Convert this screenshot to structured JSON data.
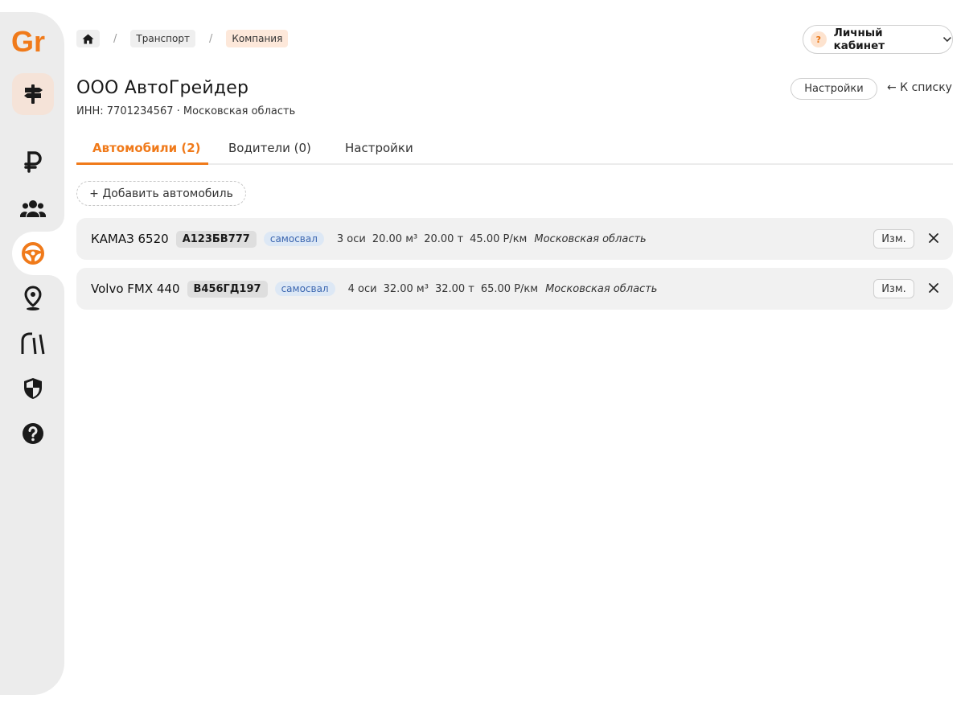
{
  "sidebar": {
    "logo": "Gr",
    "brand_color": "#f07a1a",
    "items": [
      {
        "icon": "signpost-icon",
        "name": "nav-routes"
      },
      {
        "icon": "ruble-icon",
        "name": "nav-finance"
      },
      {
        "icon": "users-icon",
        "name": "nav-users"
      },
      {
        "icon": "steering-wheel-icon",
        "name": "nav-transport",
        "active": true
      },
      {
        "icon": "map-pin-icon",
        "name": "nav-locations"
      },
      {
        "icon": "road-icon",
        "name": "nav-roads"
      },
      {
        "icon": "shield-icon",
        "name": "nav-security"
      },
      {
        "icon": "help-icon",
        "name": "nav-help"
      }
    ]
  },
  "breadcrumb": {
    "home_icon": "home-icon",
    "items": [
      "Транспорт",
      "Компания"
    ],
    "separator": "/"
  },
  "account": {
    "badge": "?",
    "label": "Личный кабинет"
  },
  "company": {
    "title": "ООО АвтоГрейдер",
    "subtitle": "ИНН: 7701234567 · Московская область",
    "settings_label": "Настройки",
    "back_label": "← К списку"
  },
  "tabs": [
    {
      "label": "Автомобили (2)",
      "active": true
    },
    {
      "label": "Водители (0)"
    },
    {
      "label": "Настройки"
    }
  ],
  "add_button": "+ Добавить автомобиль",
  "vehicles": [
    {
      "name": "КАМАЗ 6520",
      "plate": "А123БВ777",
      "type": "самосвал",
      "axles": "3 оси",
      "volume": "20.00 м³",
      "weight": "20.00 т",
      "rate": "45.00 Р/км",
      "region": "Московская область",
      "edit_label": "Изм."
    },
    {
      "name": "Volvo FMX 440",
      "plate": "В456ГД197",
      "type": "самосвал",
      "axles": "4 оси",
      "volume": "32.00 м³",
      "weight": "32.00 т",
      "rate": "65.00 Р/км",
      "region": "Московская область",
      "edit_label": "Изм."
    }
  ]
}
